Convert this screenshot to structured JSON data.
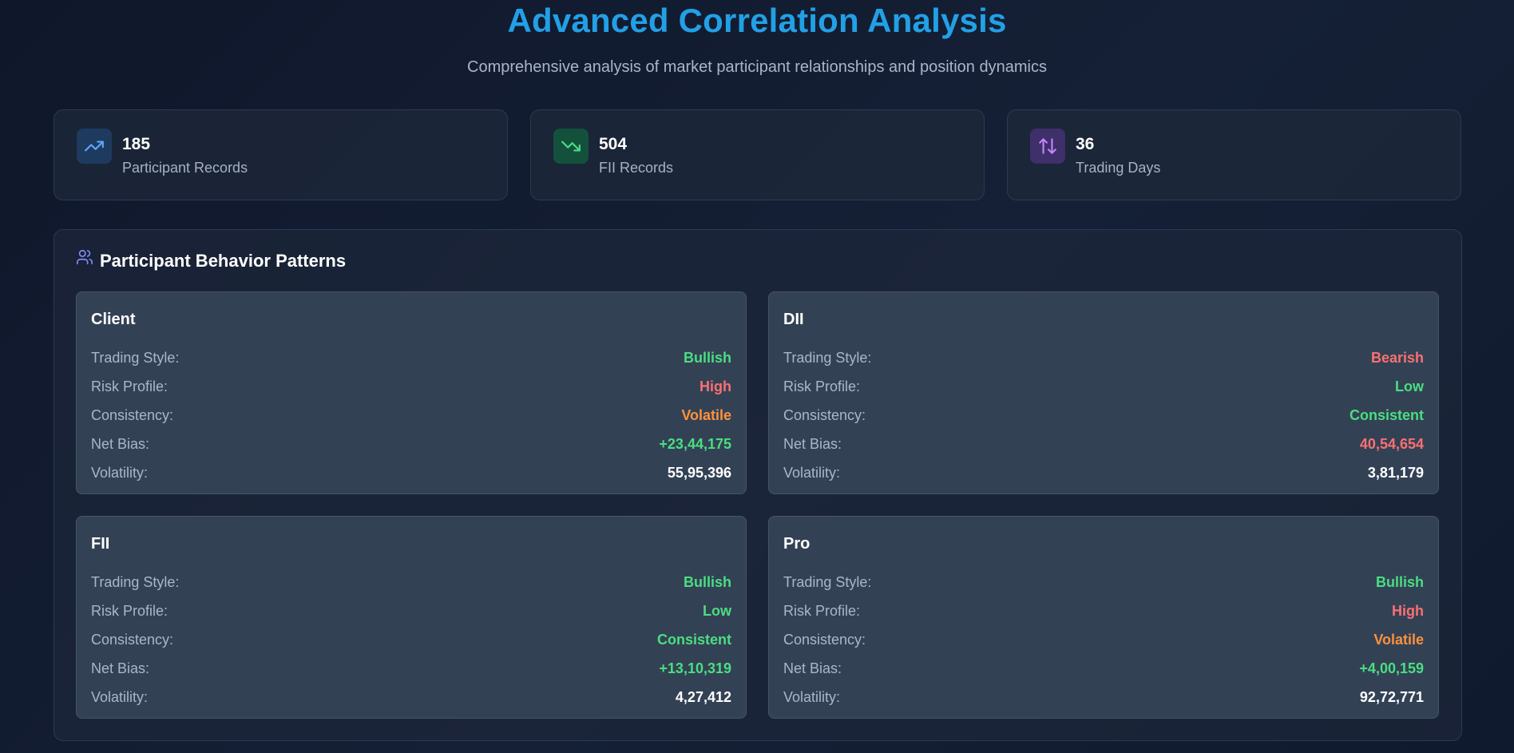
{
  "header": {
    "title": "Advanced Correlation Analysis",
    "subtitle": "Comprehensive analysis of market participant relationships and position dynamics"
  },
  "stats": [
    {
      "icon": "trending-up-icon",
      "value": "185",
      "label": "Participant Records",
      "color": "#60a5fa"
    },
    {
      "icon": "trending-down-icon",
      "value": "504",
      "label": "FII Records",
      "color": "#4ade80"
    },
    {
      "icon": "arrows-up-down-icon",
      "value": "36",
      "label": "Trading Days",
      "color": "#c084fc"
    }
  ],
  "behavior": {
    "title": "Participant Behavior Patterns",
    "icon": "users-icon",
    "labels": {
      "trading_style": "Trading Style:",
      "risk_profile": "Risk Profile:",
      "consistency": "Consistency:",
      "net_bias": "Net Bias:",
      "volatility": "Volatility:"
    },
    "participants": [
      {
        "name": "Client",
        "trading_style": "Bullish",
        "risk_profile": "High",
        "consistency": "Volatile",
        "net_bias": "+23,44,175",
        "volatility": "55,95,396"
      },
      {
        "name": "DII",
        "trading_style": "Bearish",
        "risk_profile": "Low",
        "consistency": "Consistent",
        "net_bias": "40,54,654",
        "volatility": "3,81,179"
      },
      {
        "name": "FII",
        "trading_style": "Bullish",
        "risk_profile": "Low",
        "consistency": "Consistent",
        "net_bias": "+13,10,319",
        "volatility": "4,27,412"
      },
      {
        "name": "Pro",
        "trading_style": "Bullish",
        "risk_profile": "High",
        "consistency": "Volatile",
        "net_bias": "+4,00,159",
        "volatility": "92,72,771"
      }
    ]
  },
  "colors": {
    "title": "#22a0e6",
    "positive": "#4ade80",
    "negative": "#f87171",
    "warning": "#fb923c"
  }
}
